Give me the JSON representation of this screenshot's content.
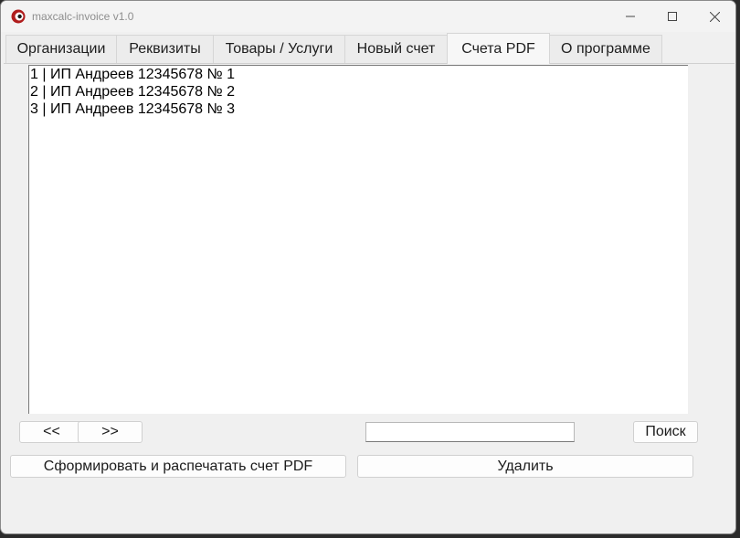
{
  "window": {
    "title": "maxcalc-invoice v1.0"
  },
  "tabs": [
    {
      "label": "Организации"
    },
    {
      "label": "Реквизиты"
    },
    {
      "label": "Товары / Услуги"
    },
    {
      "label": "Новый счет"
    },
    {
      "label": "Счета PDF",
      "active": true
    },
    {
      "label": "О программе"
    }
  ],
  "invoices": {
    "items": [
      "1 | ИП Андреев 12345678 № 1",
      "2 | ИП Андреев 12345678 № 2",
      "3 | ИП Андреев 12345678 № 3"
    ]
  },
  "pager": {
    "prev_label": "<<",
    "next_label": ">>"
  },
  "search": {
    "value": "",
    "button_label": "Поиск"
  },
  "actions": {
    "generate_label": "Сформировать и распечатать счет PDF",
    "delete_label": "Удалить"
  },
  "colors": {
    "window_bg": "#f0f0f0",
    "app_icon_red": "#b01c1c"
  }
}
